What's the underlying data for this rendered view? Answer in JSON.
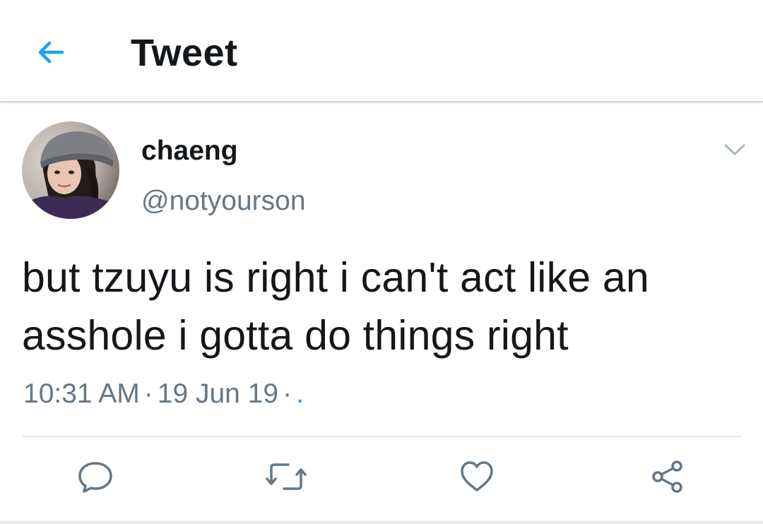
{
  "header": {
    "title": "Tweet",
    "back_icon": "arrow-left-icon",
    "accent_color": "#1da1f2"
  },
  "tweet": {
    "author": {
      "display_name": "chaeng",
      "handle": "@notyourson",
      "avatar": "profile-photo"
    },
    "text": "but tzuyu is right i can't act like an asshole i gotta do things right",
    "time": "10:31 AM",
    "date": "19 Jun 19",
    "source": ".",
    "separator": "·",
    "menu_icon": "chevron-down-icon"
  },
  "actions": [
    {
      "name": "reply",
      "icon": "speech-bubble-icon"
    },
    {
      "name": "retweet",
      "icon": "retweet-icon"
    },
    {
      "name": "like",
      "icon": "heart-icon"
    },
    {
      "name": "share",
      "icon": "share-icon"
    }
  ],
  "colors": {
    "text_primary": "#14171a",
    "text_secondary": "#657786",
    "divider": "#e1e8ed"
  }
}
